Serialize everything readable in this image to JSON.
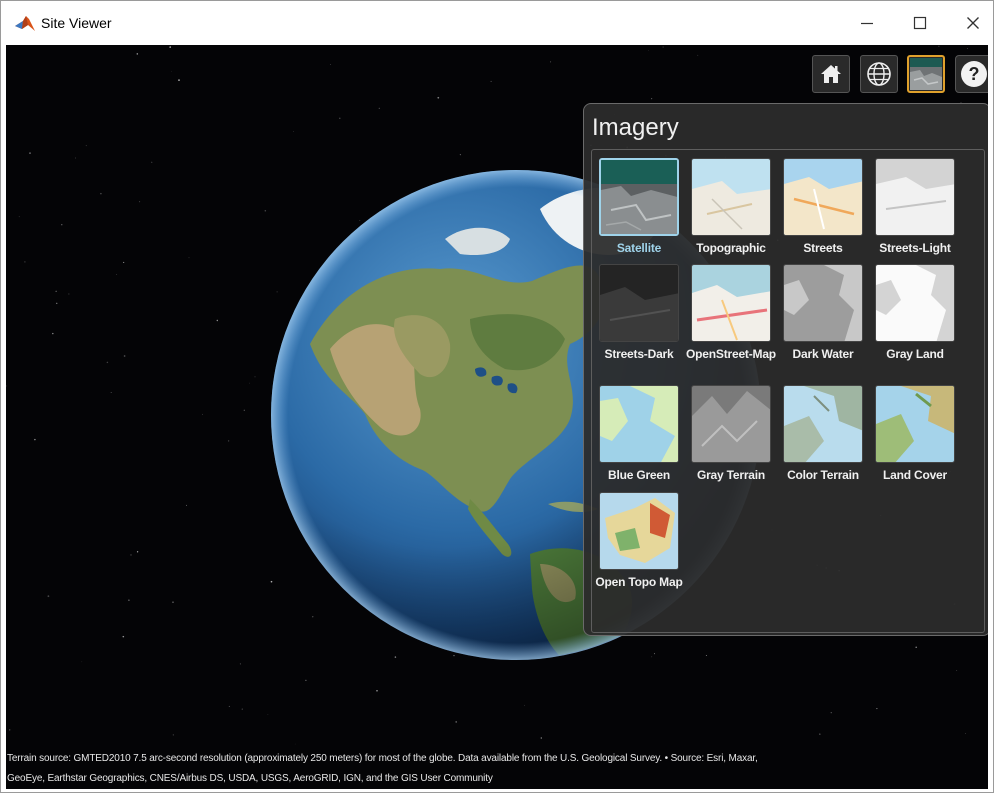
{
  "window": {
    "title": "Site Viewer",
    "controls": [
      "minimize",
      "maximize",
      "close"
    ]
  },
  "toolbar": {
    "buttons": [
      {
        "name": "home",
        "icon": "home-icon"
      },
      {
        "name": "globe",
        "icon": "globe-icon"
      },
      {
        "name": "basemap",
        "icon": "basemap-icon",
        "active": true
      },
      {
        "name": "help",
        "icon": "help-icon",
        "label": "?"
      }
    ]
  },
  "imagery": {
    "title": "Imagery",
    "options": [
      {
        "label": "Satellite",
        "selected": true
      },
      {
        "label": "Topographic"
      },
      {
        "label": "Streets"
      },
      {
        "label": "Streets-Light"
      },
      {
        "label": "Streets-Dark"
      },
      {
        "label": "OpenStreet-Map"
      },
      {
        "label": "Dark Water"
      },
      {
        "label": "Gray Land"
      },
      {
        "label": "Blue Green"
      },
      {
        "label": "Gray Terrain"
      },
      {
        "label": "Color Terrain"
      },
      {
        "label": "Land Cover"
      },
      {
        "label": "Open Topo Map"
      }
    ]
  },
  "attribution": {
    "line1": "Terrain source: GMTED2010 7.5 arc-second resolution (approximately 250 meters) for most of the globe. Data available from the U.S. Geological Survey. • Source: Esri, Maxar,",
    "line2": "GeoEye, Earthstar Geographics, CNES/Airbus DS, USDA, USGS, AeroGRID, IGN, and the GIS User Community"
  },
  "colors": {
    "space": "#040406",
    "panel": "#2c2c2c",
    "selected": "#9fd3ea",
    "active_tool": "#e0a12c",
    "ocean": "#2f6fa8"
  }
}
